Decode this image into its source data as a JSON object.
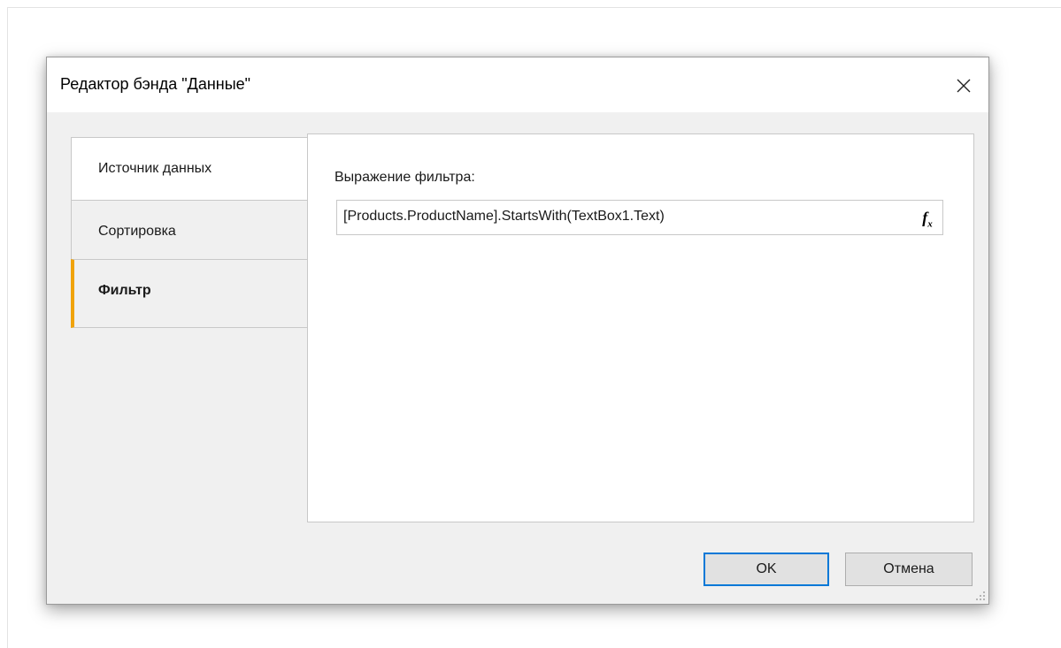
{
  "dialog": {
    "title": "Редактор бэнда \"Данные\"",
    "close_icon": "close-icon"
  },
  "tabs": [
    {
      "label": "Источник данных",
      "active": false
    },
    {
      "label": "Сортировка",
      "active": false
    },
    {
      "label": "Фильтр",
      "active": true
    }
  ],
  "filter": {
    "label": "Выражение фильтра:",
    "value": "[Products.ProductName].StartsWith(TextBox1.Text)",
    "fx_icon": "function-icon"
  },
  "buttons": {
    "ok": "OK",
    "cancel": "Отмена"
  },
  "colors": {
    "active_tab_accent": "#f0a30a",
    "default_button_border": "#0078d7"
  }
}
